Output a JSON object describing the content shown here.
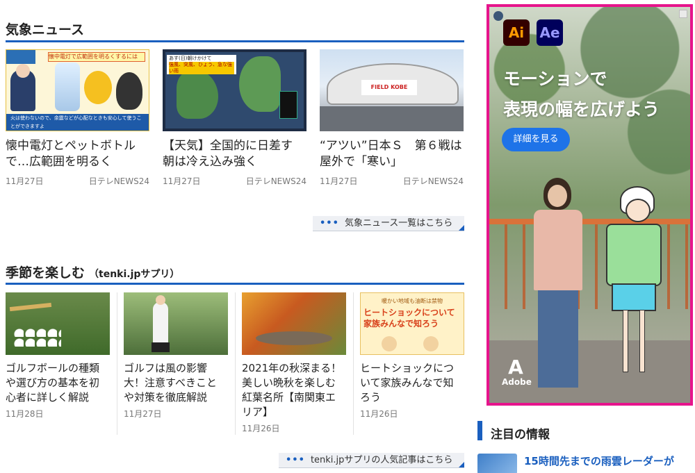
{
  "weather_news": {
    "title": "気象ニュース",
    "more_link": "気象ニュース一覧はこちら",
    "articles": [
      {
        "title_line1": "懐中電灯とペットボトル",
        "title_line2": "で…広範囲を明るく",
        "date": "11月27日",
        "source": "日テレNEWS24",
        "thumb_caption": "火は使わないので、余震などが心配なときも安心して使うことができますよ",
        "thumb_top_text": "懐中電灯で広範囲を明るくするには"
      },
      {
        "title_line1": "【天気】全国的に日差す",
        "title_line2": "朝は冷え込み強く",
        "date": "11月27日",
        "source": "日テレNEWS24",
        "thumb_banner": "あす(日)朝けかけて",
        "thumb_banner2": "強風、突風、ひょう、急な強い雨"
      },
      {
        "title_line1": "“アツい”日本Ｓ　第６戦は",
        "title_line2": "屋外で「寒い」",
        "date": "11月27日",
        "source": "日テレNEWS24",
        "thumb_sign": "FIELD KOBE"
      }
    ]
  },
  "seasonal": {
    "title": "季節を楽しむ",
    "subtitle": "（tenki.jpサプリ）",
    "more_link": "tenki.jpサプリの人気記事はこちら",
    "articles": [
      {
        "lines": [
          "ゴルフボールの種類",
          "や選び方の基本を初",
          "心者に詳しく解説"
        ],
        "date": "11月28日"
      },
      {
        "lines": [
          "ゴルフは風の影響",
          "大！注意すべきこと",
          "や対策を徹底解説"
        ],
        "date": "11月27日"
      },
      {
        "lines": [
          "2021年の秋深まる！",
          "美しい晩秋を楽しむ",
          "紅葉名所【南関東エ",
          "リア】"
        ],
        "date": "11月26日"
      },
      {
        "lines": [
          "ヒートショックにつ",
          "いて家族みんなで知",
          "ろう"
        ],
        "date": "11月26日",
        "thumb_top": "暖かい地域も油断は禁物",
        "thumb_main1": "ヒートショックについて",
        "thumb_main2": "家族みんなで知ろう"
      }
    ]
  },
  "ad": {
    "logo_ai": "Ai",
    "logo_ae": "Ae",
    "headline_line1": "モーションで",
    "headline_line2": "表現の幅を広げよう",
    "cta": "詳細を見る",
    "brand": "Adobe",
    "colors": {
      "border": "#e6148c",
      "cta": "#1e73e8"
    }
  },
  "attention": {
    "title": "注目の情報",
    "item": "15時間先までの雨雲レーダーが"
  },
  "colors": {
    "accent": "#1a5fbf"
  }
}
